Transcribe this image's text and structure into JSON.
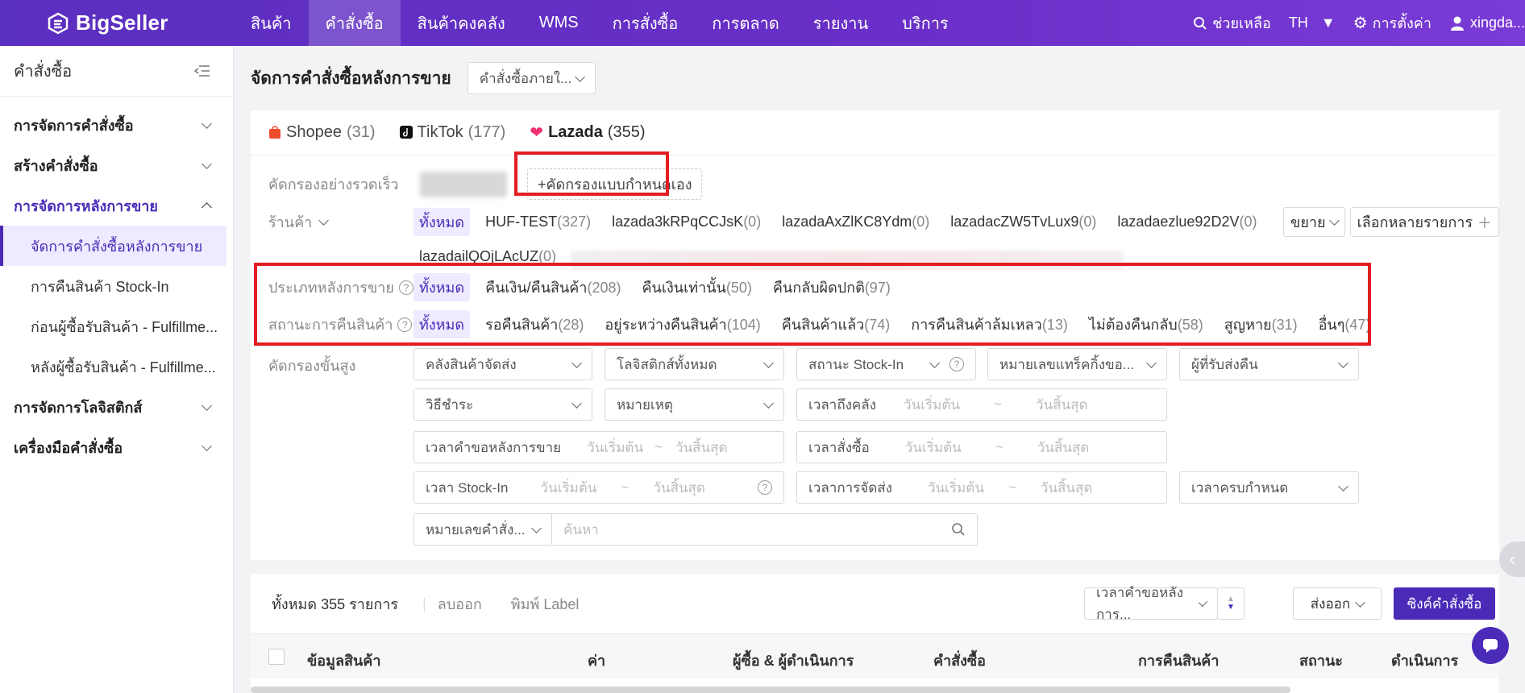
{
  "header": {
    "logo": "BigSeller",
    "nav": [
      "สินค้า",
      "คำสั่งซื้อ",
      "สินค้าคงคลัง",
      "WMS",
      "การสั่งซื้อ",
      "การตลาด",
      "รายงาน",
      "บริการ"
    ],
    "help": "ช่วยเหลือ",
    "lang": "TH",
    "settings": "การตั้งค่า",
    "user": "xingda..."
  },
  "sidebar": {
    "title": "คำสั่งซื้อ",
    "groups": [
      "การจัดการคำสั่งซื้อ",
      "สร้างคำสั่งซื้อ",
      "การจัดการหลังการขาย",
      "การจัดการโลจิสติกส์",
      "เครื่องมือคำสั่งซื้อ"
    ],
    "subs": [
      "จัดการคำสั่งซื้อหลังการขาย",
      "การคืนสินค้า Stock-In",
      "ก่อนผู้ซื้อรับสินค้า - Fulfillme...",
      "หลังผู้ซื้อรับสินค้า - Fulfillme..."
    ]
  },
  "page": {
    "title": "จัดการคำสั่งซื้อหลังการขาย",
    "order_scope": "คำสั่งซื้อภายใ..."
  },
  "tabs": [
    {
      "label": "Shopee",
      "count": "(31)"
    },
    {
      "label": "TikTok",
      "count": "(177)"
    },
    {
      "label": "Lazada",
      "count": "(355)"
    }
  ],
  "quick_filter": {
    "label": "คัดกรองอย่างรวดเร็ว",
    "custom": "+คัดกรองแบบกำหนดเอง"
  },
  "store": {
    "label": "ร้านค้า",
    "items": [
      {
        "name": "ทั้งหมด",
        "n": ""
      },
      {
        "name": "HUF-TEST",
        "n": "(327)"
      },
      {
        "name": "lazada3kRPqCCJsK",
        "n": "(0)"
      },
      {
        "name": "lazadaAxZlKC8Ydm",
        "n": "(0)"
      },
      {
        "name": "lazadacZW5TvLux9",
        "n": "(0)"
      },
      {
        "name": "lazadaezlue92D2V",
        "n": "(0)"
      }
    ],
    "items2": [
      {
        "name": "lazadailQOjLAcUZ",
        "n": "(0)"
      }
    ],
    "expand": "ขยาย",
    "multi": "เลือกหลายรายการ"
  },
  "after_sale_type": {
    "label": "ประเภทหลังการขาย",
    "items": [
      {
        "name": "ทั้งหมด",
        "n": ""
      },
      {
        "name": "คืนเงิน/คืนสินค้า",
        "n": "(208)"
      },
      {
        "name": "คืนเงินเท่านั้น",
        "n": "(50)"
      },
      {
        "name": "คืนกลับผิดปกติ",
        "n": "(97)"
      }
    ]
  },
  "return_status": {
    "label": "สถานะการคืนสินค้า",
    "items": [
      {
        "name": "ทั้งหมด",
        "n": ""
      },
      {
        "name": "รอคืนสินค้า",
        "n": "(28)"
      },
      {
        "name": "อยู่ระหว่างคืนสินค้า",
        "n": "(104)"
      },
      {
        "name": "คืนสินค้าแล้ว",
        "n": "(74)"
      },
      {
        "name": "การคืนสินค้าล้มเหลว",
        "n": "(13)"
      },
      {
        "name": "ไม่ต้องคืนกลับ",
        "n": "(58)"
      },
      {
        "name": "สูญหาย",
        "n": "(31)"
      },
      {
        "name": "อื่นๆ",
        "n": "(47)"
      }
    ]
  },
  "advanced": {
    "label": "คัดกรองขั้นสูง",
    "warehouse": "คลังสินค้าจัดส่ง",
    "logistics": "โลจิสติกส์ทั้งหมด",
    "stockin_status": "สถานะ Stock-In",
    "tracking": "หมายเลขแทร็คกิ้งขอ...",
    "recipient": "ผู้ที่รับส่งคืน",
    "payment": "วิธีชำระ",
    "note": "หมายเหตุ",
    "arrive_time": "เวลาถึงคลัง",
    "request_time": "เวลาคำขอหลังการขาย",
    "order_time": "เวลาสั่งซื้อ",
    "stockin_time": "เวลา Stock-In",
    "ship_time": "เวลาการจัดส่ง",
    "due_time": "เวลาครบกำหนด",
    "start": "วันเริ่มต้น",
    "end": "วันสิ้นสุด",
    "tilde": "~",
    "search_type": "หมายเลขคำสั่ง...",
    "search_ph": "ค้นหา"
  },
  "list": {
    "total": "ทั้งหมด 355 รายการ",
    "delete": "ลบออก",
    "print": "พิมพ์ Label",
    "sort": "เวลาคำขอหลังการ...",
    "export": "ส่งออก",
    "sync": "ซิงค์คำสั่งซื้อ",
    "cols": [
      "ข้อมูลสินค้า",
      "ค่า",
      "ผู้ซื้อ & ผู้ดำเนินการ",
      "คำสั่งซื้อ",
      "การคืนสินค้า",
      "สถานะ",
      "ดำเนินการ"
    ]
  },
  "colors": {
    "accent": "#4a2bb8",
    "highlight": "#e41d23",
    "nav": "#5b2fc0"
  }
}
